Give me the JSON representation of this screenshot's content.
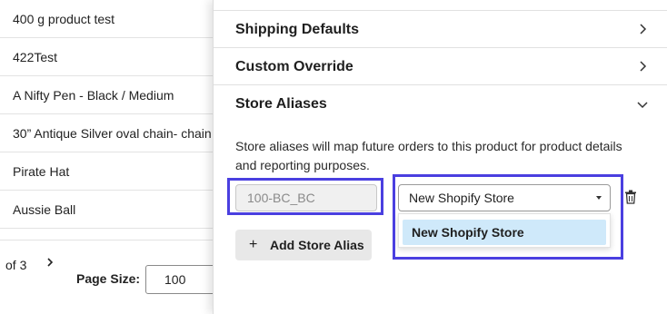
{
  "product_list": {
    "rows": [
      "400 g product test",
      "422Test",
      "A Nifty Pen - Black / Medium",
      "30” Antique Silver oval chain- chain",
      "Pirate Hat",
      "Aussie Ball"
    ],
    "pagination": {
      "of_text": "of 3",
      "next_glyph": "›"
    },
    "page_size": {
      "label": "Page Size:",
      "value": "100"
    }
  },
  "panel": {
    "sections": [
      {
        "title": "Shipping Defaults",
        "state": "collapsed"
      },
      {
        "title": "Custom Override",
        "state": "collapsed"
      }
    ],
    "store_aliases": {
      "title": "Store Aliases",
      "state": "expanded",
      "description": "Store aliases will map future orders to this product for product details and reporting purposes.",
      "alias_value": "100-BC_BC",
      "store_select": {
        "value": "New Shopify Store",
        "options": [
          "New Shopify Store"
        ]
      },
      "add_button": {
        "plus": "+",
        "label": "Add Store Alias"
      }
    }
  },
  "icons": {
    "section_chevron": "chevron-right-icon",
    "aliases_chevron": "chevron-down-icon",
    "delete": "trash-icon"
  },
  "colors": {
    "highlight": "#4a3fe0",
    "selected_option": "#cfe9fa",
    "add_button_bg": "#e8e8e8"
  }
}
